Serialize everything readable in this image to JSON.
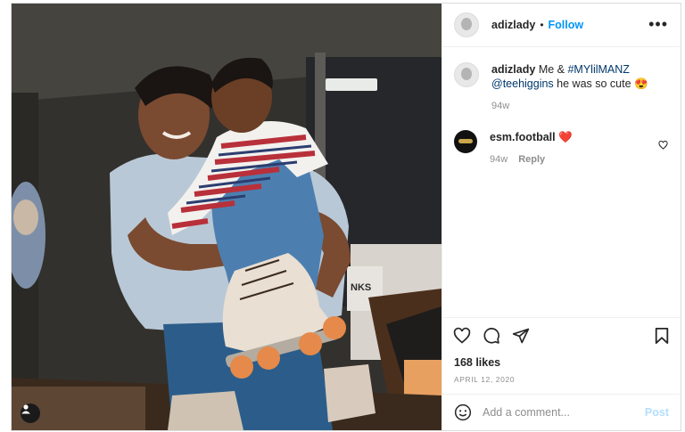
{
  "post": {
    "username": "adizlady",
    "follow_label": "Follow",
    "more_icon": "more-options-icon",
    "caption": {
      "username": "adizlady",
      "text_before": "Me &",
      "hashtag": "#MYlilMANZ",
      "mention": "@teehiggins",
      "text_after": "he was so cute 😍",
      "time": "94w"
    },
    "comments": [
      {
        "username": "esm.football",
        "text": "❤️",
        "time": "94w",
        "reply_label": "Reply"
      }
    ],
    "likes": "168 likes",
    "date": "APRIL 12, 2020",
    "add_comment_placeholder": "Add a comment...",
    "post_button": "Post",
    "photo_sign_text": "NKS"
  },
  "colors": {
    "accent": "#0095f6",
    "link": "#00376b",
    "muted": "#8e8e8e",
    "post_disabled": "#b2dffc"
  }
}
